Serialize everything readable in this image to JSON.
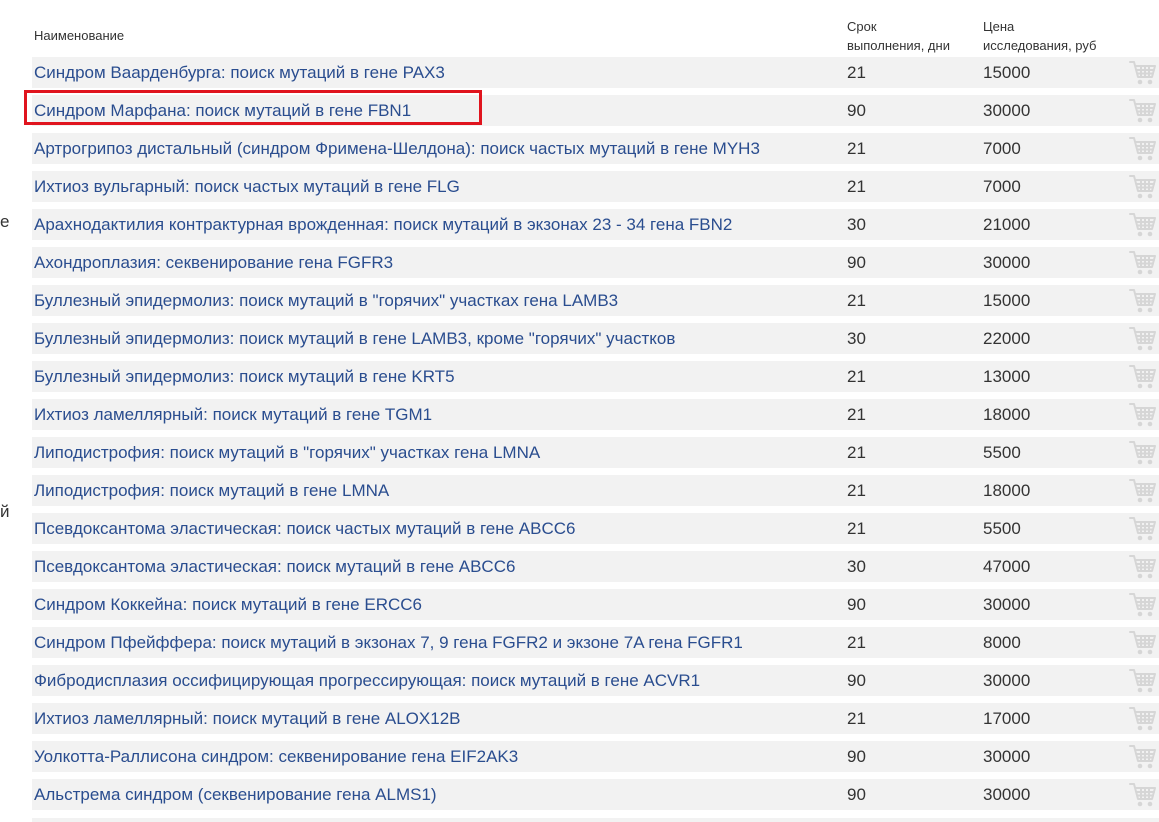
{
  "edge_fragments": [
    "е",
    "й"
  ],
  "table": {
    "headers": {
      "name": "Наименование",
      "days_line1": "Срок",
      "days_line2": "выполнения, дни",
      "price_line1": "Цена",
      "price_line2": "исследования, руб"
    },
    "rows": [
      {
        "name": "Синдром Ваарденбурга: поиск мутаций в гене PAX3",
        "days": "21",
        "price": "15000"
      },
      {
        "name": "Синдром Марфана: поиск мутаций в гене FBN1",
        "days": "90",
        "price": "30000",
        "highlighted": true
      },
      {
        "name": "Артрогрипоз дистальный (синдром Фримена-Шелдона): поиск частых мутаций в гене MYH3",
        "days": "21",
        "price": "7000"
      },
      {
        "name": "Ихтиоз вульгарный: поиск частых мутаций в гене FLG",
        "days": "21",
        "price": "7000"
      },
      {
        "name": "Арахнодактилия контрактурная врожденная: поиск мутаций в экзонах 23 - 34 гена FBN2",
        "days": "30",
        "price": "21000"
      },
      {
        "name": "Ахондроплазия: секвенирование гена FGFR3",
        "days": "90",
        "price": "30000"
      },
      {
        "name": "Буллезный эпидермолиз: поиск мутаций в \"горячих\" участках гена LAMB3",
        "days": "21",
        "price": "15000"
      },
      {
        "name": "Буллезный эпидермолиз: поиск мутаций в гене LAMB3, кроме \"горячих\" участков",
        "days": "30",
        "price": "22000"
      },
      {
        "name": "Буллезный эпидермолиз: поиск мутаций в гене KRT5",
        "days": "21",
        "price": "13000"
      },
      {
        "name": "Ихтиоз ламеллярный: поиск мутаций в гене TGM1",
        "days": "21",
        "price": "18000"
      },
      {
        "name": "Липодистрофия: поиск мутаций в \"горячих\" участках гена LMNA",
        "days": "21",
        "price": "5500"
      },
      {
        "name": "Липодистрофия: поиск мутаций в гене LMNA",
        "days": "21",
        "price": "18000"
      },
      {
        "name": "Псевдоксантома эластическая: поиск частых мутаций в гене ABCC6",
        "days": "21",
        "price": "5500"
      },
      {
        "name": "Псевдоксантома эластическая: поиск мутаций в гене ABCC6",
        "days": "30",
        "price": "47000"
      },
      {
        "name": "Синдром Коккейна: поиск мутаций в гене ERCC6",
        "days": "90",
        "price": "30000"
      },
      {
        "name": "Синдром Пфейффера: поиск мутаций в экзонах 7, 9 гена FGFR2 и экзоне 7A гена FGFR1",
        "days": "21",
        "price": "8000"
      },
      {
        "name": "Фибродисплазия оссифицирующая прогрессирующая: поиск мутаций в гене ACVR1",
        "days": "90",
        "price": "30000"
      },
      {
        "name": "Ихтиоз ламеллярный: поиск мутаций в гене ALOX12B",
        "days": "21",
        "price": "17000"
      },
      {
        "name": "Уолкотта-Раллисона синдром: секвенирование гена EIF2AK3",
        "days": "90",
        "price": "30000"
      },
      {
        "name": "Альстрема синдром (секвенирование гена ALMS1)",
        "days": "90",
        "price": "30000"
      }
    ]
  },
  "icons": {
    "row_action": "cart-icon"
  },
  "colors": {
    "link": "#2a4d8f",
    "row_background": "#f2f2f2",
    "highlight_border": "#e0141e",
    "cart_icon": "#d6d6d6"
  }
}
